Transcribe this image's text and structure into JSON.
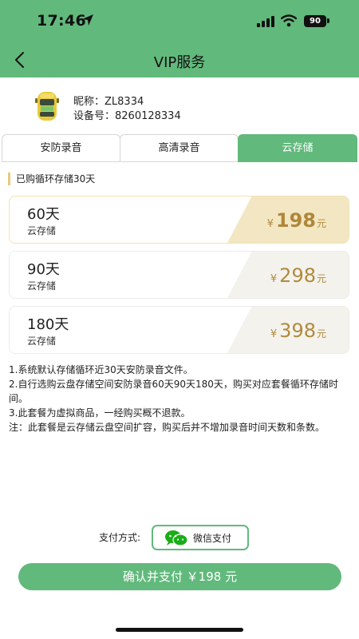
{
  "status_bar": {
    "time": "17:46",
    "battery": "90"
  },
  "nav": {
    "title": "VIP服务",
    "back_icon": "chevron-left-icon"
  },
  "device": {
    "nickname": "昵称：ZL8334",
    "device_id": "设备号：8260128334",
    "icon": "car-icon"
  },
  "tabs": [
    {
      "label": "安防录音",
      "selected": false
    },
    {
      "label": "高清录音",
      "selected": false
    },
    {
      "label": "云存储",
      "selected": true
    }
  ],
  "notice": "已购循环存储30天",
  "plans": [
    {
      "days": "60天",
      "type": "云存储",
      "currency": "¥",
      "price": "198",
      "unit": "元",
      "selected": true
    },
    {
      "days": "90天",
      "type": "云存储",
      "currency": "¥",
      "price": "298",
      "unit": "元",
      "selected": false
    },
    {
      "days": "180天",
      "type": "云存储",
      "currency": "¥",
      "price": "398",
      "unit": "元",
      "selected": false
    }
  ],
  "description": [
    "1.系统默认存储循环近30天安防录音文件。",
    "2.自行选购云盘存储空间安防录音60天90天180天，购买对应套餐循环存储时间。",
    "3.此套餐为虚拟商品，一经购买概不退款。",
    "注：此套餐是云存储云盘空间扩容，购买后并不增加录音时间天数和条数。"
  ],
  "payment": {
    "label": "支付方式:",
    "method": "微信支付",
    "icon": "wechat-icon"
  },
  "confirm_button": "确认并支付 ￥198 元",
  "colors": {
    "primary_green": "#62b97c",
    "price_gold": "#b08a3e",
    "selected_panel": "#f2e7c2"
  }
}
